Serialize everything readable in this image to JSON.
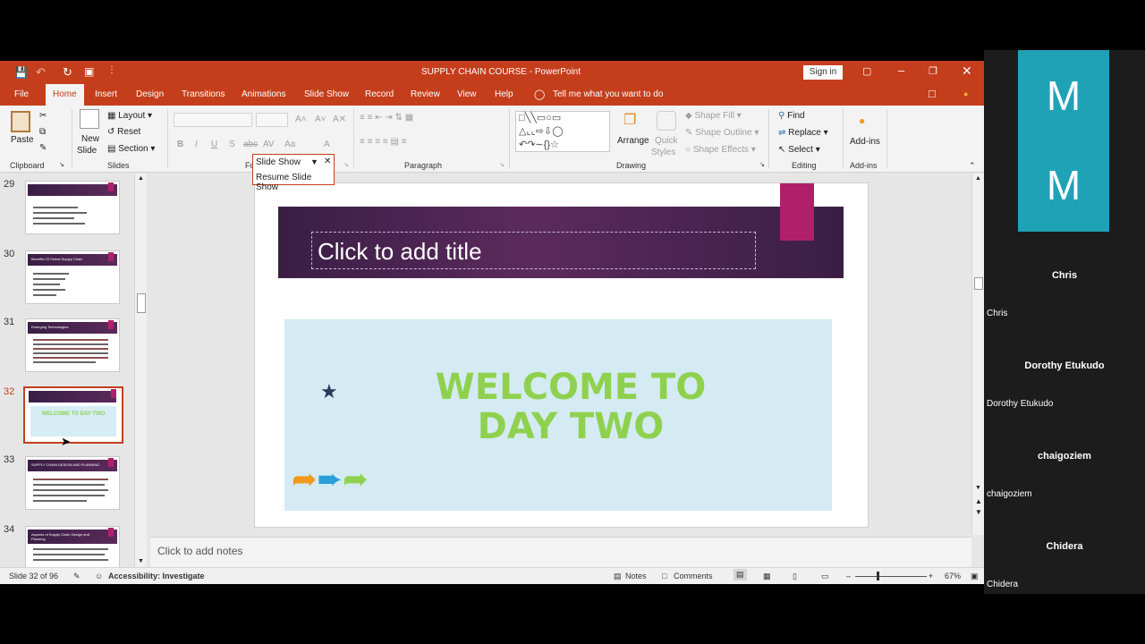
{
  "window": {
    "title": "SUPPLY CHAIN COURSE  -  PowerPoint",
    "sign_in": "Sign in",
    "qat_icons": [
      "save-icon",
      "undo-icon",
      "redo-icon",
      "present-icon",
      "customize-icon"
    ]
  },
  "tabs": [
    "File",
    "Home",
    "Insert",
    "Design",
    "Transitions",
    "Animations",
    "Slide Show",
    "Record",
    "Review",
    "View",
    "Help"
  ],
  "active_tab": "Home",
  "tell_me": "Tell me what you want to do",
  "ribbon": {
    "clipboard": {
      "label": "Clipboard",
      "paste": "Paste"
    },
    "slides": {
      "label": "Slides",
      "new_slide_1": "New",
      "new_slide_2": "Slide",
      "layout": "Layout",
      "reset": "Reset",
      "section": "Section"
    },
    "font": {
      "label_fragment": "Fo"
    },
    "paragraph": {
      "label": "Paragraph"
    },
    "drawing": {
      "label": "Drawing",
      "arrange": "Arrange",
      "quick_styles_1": "Quick",
      "quick_styles_2": "Styles",
      "shape_fill": "Shape Fill",
      "shape_outline": "Shape Outline",
      "shape_effects": "Shape Effects"
    },
    "editing": {
      "label": "Editing",
      "find": "Find",
      "replace": "Replace",
      "select": "Select"
    },
    "addins": {
      "label": "Add-ins",
      "button": "Add-ins"
    }
  },
  "slideshow_popup": {
    "title": "Slide Show",
    "item": "Resume Slide Show"
  },
  "thumbnails": [
    {
      "num": "29",
      "title": ""
    },
    {
      "num": "30",
      "title": "Benefits Of Global Supply Chain"
    },
    {
      "num": "31",
      "title": "Emerging Technologies"
    },
    {
      "num": "32",
      "title": "WELCOME TO DAY TWO",
      "selected": true
    },
    {
      "num": "33",
      "title": "SUPPLY CHAIN DESIGN AND PLANNING"
    },
    {
      "num": "34",
      "title": "Aspects of Supply Chain Design and Planning"
    }
  ],
  "slide": {
    "title_placeholder": "Click to add title",
    "welcome_line1": "WELCOME TO",
    "welcome_line2": "DAY TWO",
    "accent": "#b0206a",
    "banner": "#3a1e45",
    "text_color": "#8fd14f"
  },
  "notes_placeholder": "Click to add notes",
  "status": {
    "slide_pos": "Slide 32 of 96",
    "accessibility": "Accessibility: Investigate",
    "notes": "Notes",
    "comments": "Comments",
    "zoom": "67%"
  },
  "participants": [
    {
      "name": "Chris",
      "sub": "Chris"
    },
    {
      "name": "Dorothy Etukudo",
      "sub": "Dorothy Etukudo"
    },
    {
      "name": "chaigoziem",
      "sub": "chaigoziem"
    },
    {
      "name": "Chidera",
      "sub": "Chidera"
    }
  ],
  "tiles": [
    {
      "letter": "M"
    },
    {
      "letter": "M"
    }
  ],
  "colors": {
    "brand": "#c43e1c",
    "tile": "#1fa2b6"
  }
}
